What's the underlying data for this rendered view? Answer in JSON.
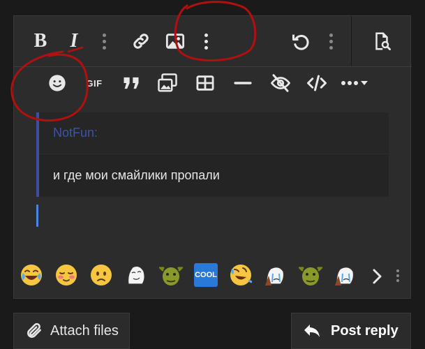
{
  "toolbar": {
    "bold_label": "B",
    "italic_label": "I",
    "gif_label": "GIF",
    "icons": [
      "bold-icon",
      "italic-icon",
      "more-vertical-icon",
      "link-icon",
      "image-icon",
      "more-vertical-icon",
      "undo-icon",
      "more-vertical-icon",
      "preview-icon",
      "smilie-icon",
      "gif-icon",
      "quote-icon",
      "media-icon",
      "table-icon",
      "horizontal-rule-icon",
      "hide-icon",
      "code-icon",
      "more-icon"
    ]
  },
  "quote": {
    "author": "NotFun:",
    "text": "и где мои смайлики пропали"
  },
  "smilies": {
    "items": [
      "crying-laughing",
      "blushing",
      "worried",
      "meme-face",
      "shrek",
      "cool",
      "rolling-laughing",
      "crying-meme",
      "shrek",
      "crying-meme"
    ],
    "cool_label": "COOL"
  },
  "actions": {
    "attach_label": "Attach files",
    "post_label": "Post reply"
  },
  "colors": {
    "annotation": "#b01010",
    "quote_bar": "#3b4f9c",
    "caret": "#4a86e8"
  }
}
